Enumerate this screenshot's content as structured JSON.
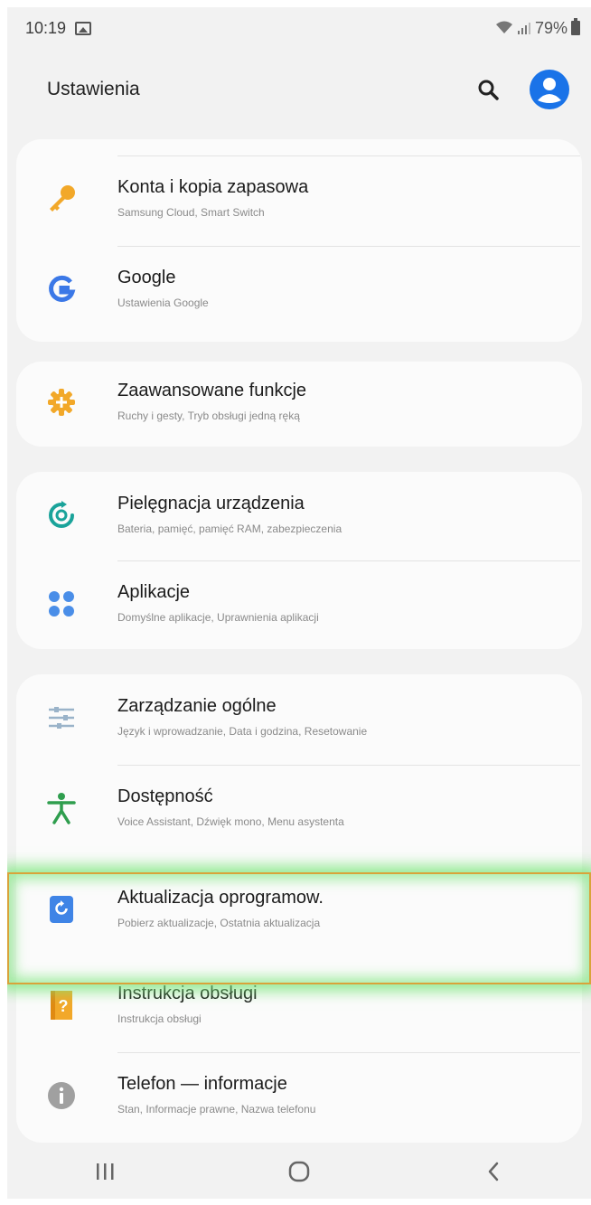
{
  "status_bar": {
    "time": "10:19",
    "battery": "79%",
    "icons": [
      "gallery-icon",
      "wifi-icon",
      "signal-icon",
      "battery-icon"
    ]
  },
  "header": {
    "title": "Ustawienia",
    "actions": [
      "search-icon",
      "profile-icon"
    ]
  },
  "colors": {
    "accent": "#1a73e8",
    "background": "#f2f2f2",
    "card": "#fbfbfb",
    "highlight_border": "#d9a33a",
    "highlight_glow": "#78e678"
  },
  "settings": {
    "accounts": {
      "title": "Konta i kopia zapasowa",
      "subtitle": "Samsung Cloud, Smart Switch",
      "icon": "key-icon"
    },
    "google": {
      "title": "Google",
      "subtitle": "Ustawienia Google",
      "icon": "google-icon"
    },
    "advanced": {
      "title": "Zaawansowane funkcje",
      "subtitle": "Ruchy i gesty, Tryb obsługi jedną ręką",
      "icon": "gear-plus-icon"
    },
    "device_care": {
      "title": "Pielęgnacja urządzenia",
      "subtitle": "Bateria, pamięć, pamięć RAM, zabezpieczenia",
      "icon": "device-care-icon"
    },
    "apps": {
      "title": "Aplikacje",
      "subtitle": "Domyślne aplikacje, Uprawnienia aplikacji",
      "icon": "apps-dots-icon"
    },
    "general": {
      "title": "Zarządzanie ogólne",
      "subtitle": "Język i wprowadzanie, Data i godzina, Resetowanie",
      "icon": "sliders-icon"
    },
    "accessibility": {
      "title": "Dostępność",
      "subtitle": "Voice Assistant, Dźwięk mono, Menu asystenta",
      "icon": "accessibility-icon"
    },
    "software_update": {
      "title": "Aktualizacja oprogramow.",
      "subtitle": "Pobierz aktualizacje, Ostatnia aktualizacja",
      "icon": "software-update-icon"
    },
    "manual": {
      "title": "Instrukcja obsługi",
      "subtitle": "Instrukcja obsługi",
      "icon": "manual-icon"
    },
    "about": {
      "title": "Telefon — informacje",
      "subtitle": "Stan, Informacje prawne, Nazwa telefonu",
      "icon": "info-icon"
    }
  },
  "nav_bar": [
    "recents-icon",
    "home-icon",
    "back-icon"
  ]
}
